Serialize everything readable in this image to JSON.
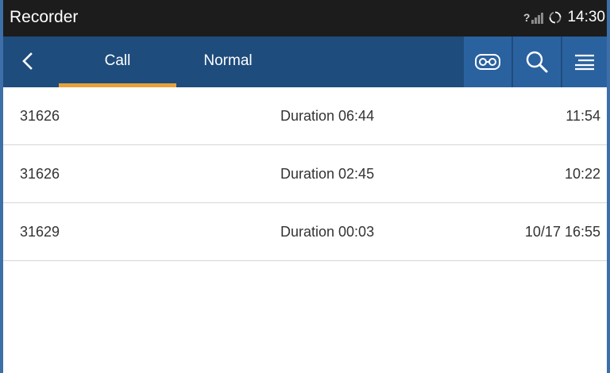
{
  "app": {
    "title": "Recorder"
  },
  "status": {
    "signal_mark": "?",
    "time": "14:30"
  },
  "tabs": [
    {
      "label": "Call",
      "active": true
    },
    {
      "label": "Normal",
      "active": false
    }
  ],
  "icons": {
    "back": "chevron-left-icon",
    "tape": "cassette-tape-icon",
    "search": "search-icon",
    "menu": "menu-icon"
  },
  "colors": {
    "status_bar": "#1c1c1c",
    "toolbar": "#1e4c7c",
    "toolbar_button": "#2a62a0",
    "tab_indicator": "#e8a13a"
  },
  "recordings": [
    {
      "number": "31626",
      "duration": "Duration 06:44",
      "time": "11:54"
    },
    {
      "number": "31626",
      "duration": "Duration 02:45",
      "time": "10:22"
    },
    {
      "number": "31629",
      "duration": "Duration 00:03",
      "time": "10/17 16:55"
    }
  ]
}
